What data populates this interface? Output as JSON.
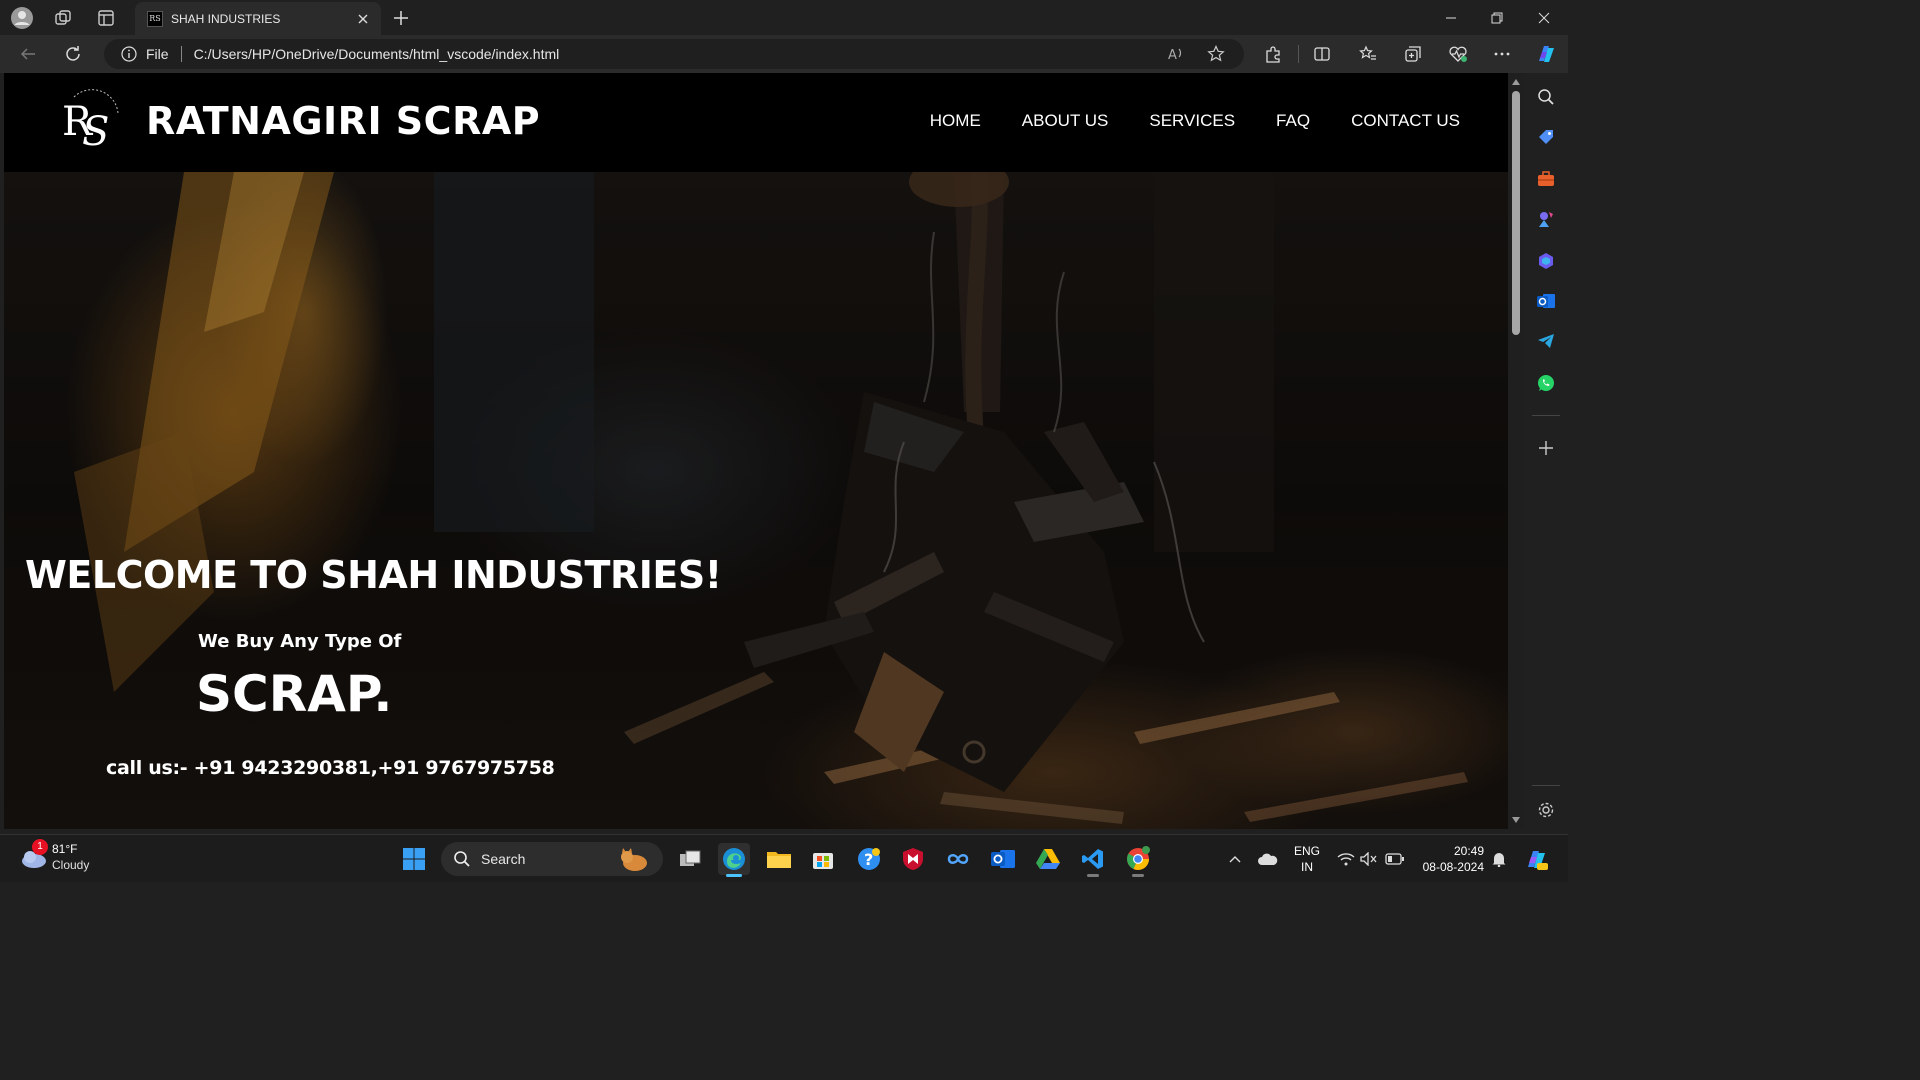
{
  "browser": {
    "tab": {
      "title": "SHAH INDUSTRIES",
      "favicon_text": "RS"
    },
    "address": {
      "protocol_label": "File",
      "url": "C:/Users/HP/OneDrive/Documents/html_vscode/index.html"
    }
  },
  "site": {
    "logo_text": "RS",
    "brand": "RATNAGIRI SCRAP",
    "nav": [
      "HOME",
      "ABOUT US",
      "SERVICES",
      "FAQ",
      "CONTACT US"
    ],
    "hero": {
      "headline": "WELCOME TO SHAH INDUSTRIES!",
      "subheadline": "We Buy Any Type Of",
      "highlight": "SCRAP.",
      "call": "call us:- +91 9423290381,+91 9767975758"
    }
  },
  "taskbar": {
    "weather": {
      "badge": "1",
      "temp": "81°F",
      "condition": "Cloudy"
    },
    "search_label": "Search",
    "language": {
      "line1": "ENG",
      "line2": "IN"
    },
    "clock": {
      "time": "20:49",
      "date": "08-08-2024"
    }
  },
  "colors": {
    "brand_bg": "#000000",
    "accent_blue": "#4cc2ff",
    "chrome_bg": "#202020"
  }
}
